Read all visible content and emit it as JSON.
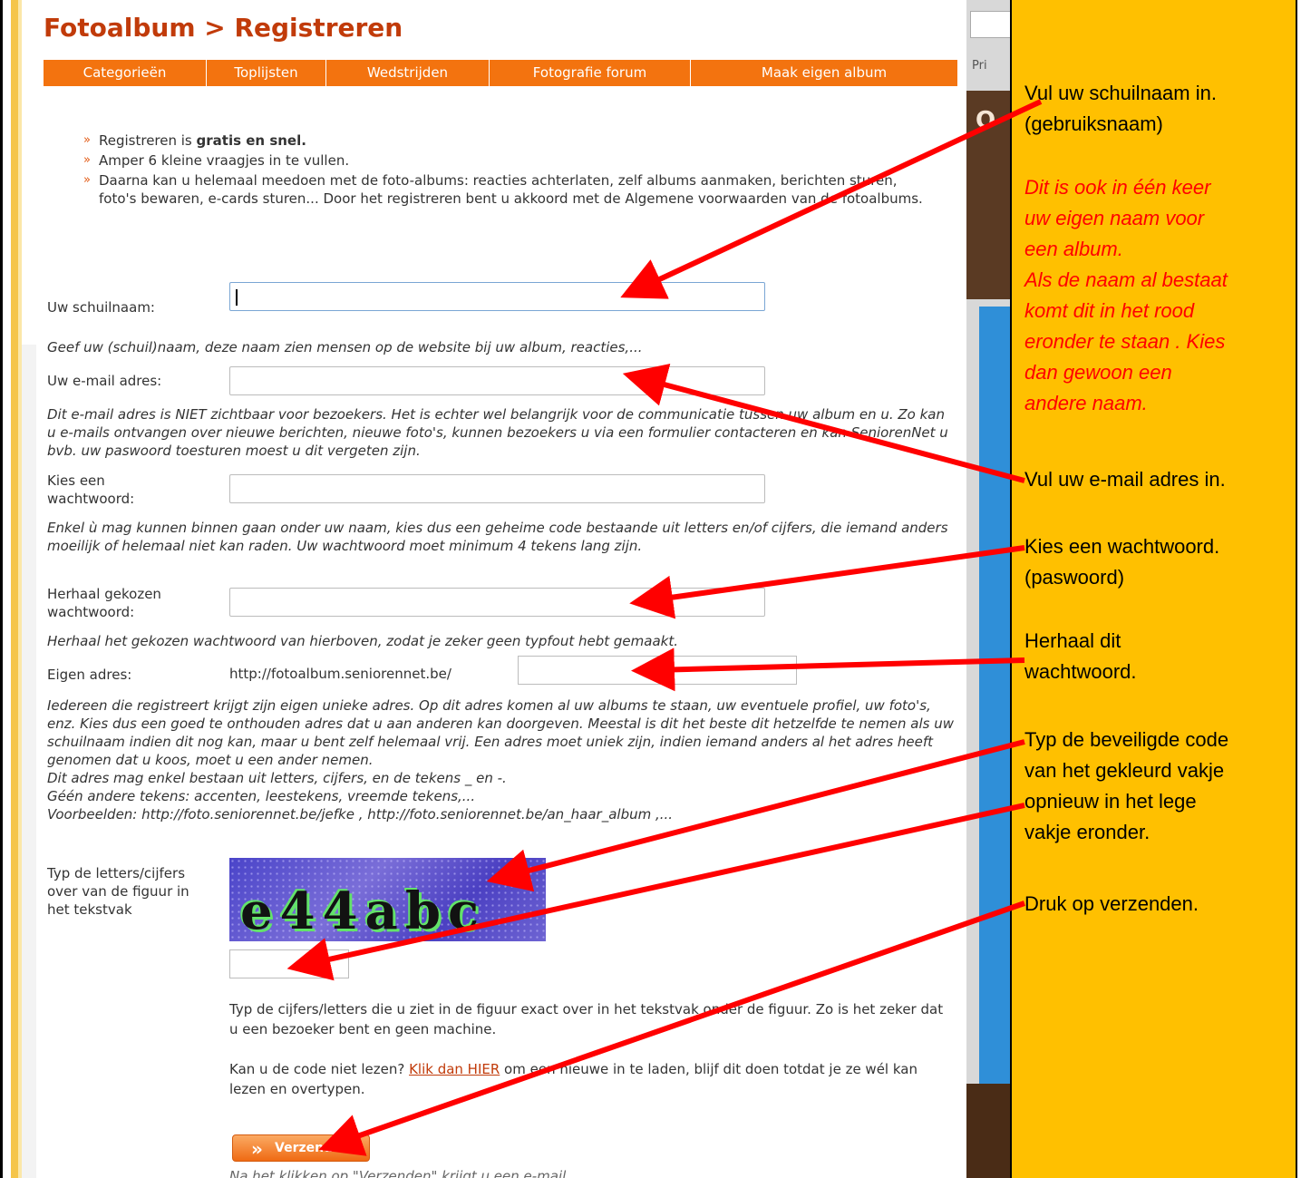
{
  "page": {
    "title": "Fotoalbum > Registreren"
  },
  "nav": {
    "items": [
      "Categorieën",
      "Toplijsten",
      "Wedstrijden",
      "Fotografie forum",
      "Maak eigen album"
    ]
  },
  "intro": {
    "bullet_marker": "»",
    "b1_pre": "Registreren is ",
    "b1_bold": "gratis en snel.",
    "b2": "Amper 6 kleine vraagjes in te vullen.",
    "b3": "Daarna kan u helemaal meedoen met de foto-albums: reacties achterlaten, zelf albums aanmaken, berichten sturen, foto's bewaren, e-cards sturen... Door het registreren bent u akkoord met de Algemene voorwaarden van de fotoalbums."
  },
  "form": {
    "username_label": "Uw schuilnaam:",
    "username_help": "Geef uw (schuil)naam, deze naam zien mensen op de website bij uw album, reacties,...",
    "email_label": "Uw e-mail adres:",
    "email_help": "Dit e-mail adres is NIET zichtbaar voor bezoekers. Het is echter wel belangrijk voor de communicatie tussen uw album en u. Zo kan u e-mails ontvangen over nieuwe berichten, nieuwe foto's, kunnen bezoekers u via een formulier contacteren en kan SeniorenNet u bvb. uw paswoord toesturen moest u dit vergeten zijn.",
    "password_label_1": "Kies een",
    "password_label_2": "wachtwoord:",
    "password_help": "Enkel ù mag kunnen binnen gaan onder uw naam, kies dus een geheime code bestaande uit letters en/of cijfers, die iemand anders moeilijk of helemaal niet kan raden. Uw wachtwoord moet minimum 4 tekens lang zijn.",
    "repeat_label_1": "Herhaal gekozen",
    "repeat_label_2": "wachtwoord:",
    "repeat_help": "Herhaal het gekozen wachtwoord van hierboven, zodat je zeker geen typfout hebt gemaakt.",
    "address_label": "Eigen adres:",
    "address_prefix": "http://fotoalbum.seniorennet.be/",
    "address_help_1": "Iedereen die registreert krijgt zijn eigen unieke adres. Op dit adres komen al uw albums te staan, uw eventuele profiel, uw foto's, enz. Kies dus een goed te onthouden adres dat u aan anderen kan doorgeven. Meestal is dit het beste dit hetzelfde te nemen als uw schuilnaam indien dit nog kan, maar u bent zelf helemaal vrij. Een adres moet uniek zijn, indien iemand anders al het adres heeft genomen dat u koos, moet u een ander nemen.",
    "address_help_2": "Dit adres mag enkel bestaan uit letters, cijfers, en de tekens _ en -.",
    "address_help_3": "Géén andere tekens: accenten, leestekens, vreemde tekens,...",
    "address_help_4": "Voorbeelden: http://foto.seniorennet.be/jefke , http://foto.seniorennet.be/an_haar_album ,...",
    "captcha_label_1": "Typ de letters/cijfers",
    "captcha_label_2": "over van de figuur in",
    "captcha_label_3": "het tekstvak",
    "captcha_code": "e44abc",
    "captcha_help": "Typ de cijfers/letters die u ziet in de figuur exact over in het tekstvak onder de figuur. Zo is het zeker dat u een bezoeker bent en geen machine.",
    "reload_pre": "Kan u de code niet lezen? ",
    "reload_link": "Klik dan HIER",
    "reload_post": " om een nieuwe in te laden, blijf dit doen totdat je ze wél kan lezen en overtypen.",
    "submit_label": "Verzenden",
    "after_submit": "Na het klikken op \"Verzenden\" krijgt u een e-mail ..."
  },
  "right_column": {
    "pri_text": "Pri",
    "brown_letter": "O"
  },
  "annotations": {
    "a1_1": "Vul uw schuilnaam in.",
    "a1_2": "(gebruiksnaam)",
    "a2_1": "Dit is ook in één keer",
    "a2_2": "uw eigen naam voor",
    "a2_3": "een album.",
    "a2_4": "Als de naam al bestaat",
    "a2_5": "komt dit in het rood",
    "a2_6": "eronder te staan . Kies",
    "a2_7": "dan gewoon een",
    "a2_8": "andere naam.",
    "a3": "Vul uw e-mail adres in.",
    "a4_1": "Kies een wachtwoord.",
    "a4_2": "(paswoord)",
    "a5_1": "Herhaal dit",
    "a5_2": "wachtwoord.",
    "a6_1": "Typ de beveiligde code",
    "a6_2": "van het gekleurd vakje",
    "a6_3": "opnieuw in het lege",
    "a6_4": "vakje eronder.",
    "a7": "Druk op verzenden."
  },
  "colors": {
    "title": "#c13b0a",
    "nav_bg": "#f3730f",
    "annotation_bg": "#ffc000",
    "arrow": "#ff0000",
    "annotation_red": "#ff0000"
  }
}
